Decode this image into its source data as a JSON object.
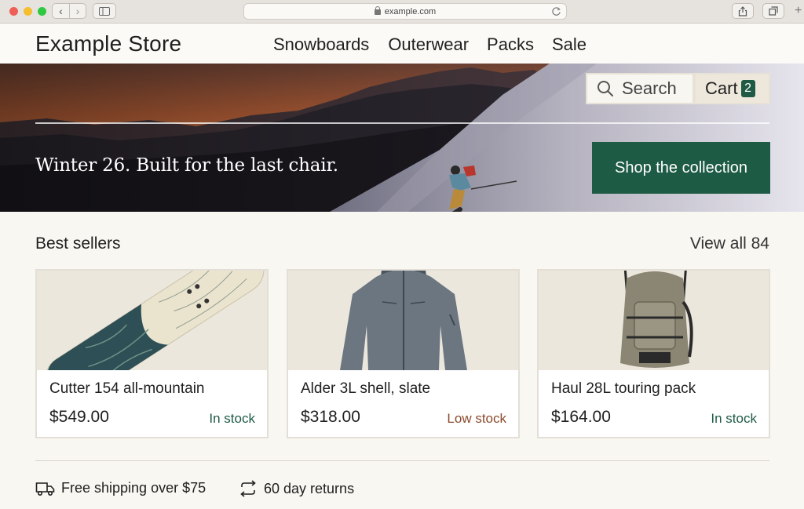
{
  "browser": {
    "url": "example.com"
  },
  "header": {
    "store_name": "Example Store",
    "nav": [
      "Snowboards",
      "Outerwear",
      "Packs",
      "Sale"
    ]
  },
  "hero": {
    "search_label": "Search",
    "cart_label": "Cart",
    "cart_count": "2",
    "headline": "Winter 26. Built for the last chair.",
    "cta": "Shop the collection"
  },
  "best_sellers": {
    "title": "Best sellers",
    "view_all": "View all 84",
    "products": [
      {
        "name": "Cutter 154 all-mountain",
        "price": "$549.00",
        "stock": "In stock"
      },
      {
        "name": "Alder 3L shell, slate",
        "price": "$318.00",
        "stock": "Low stock"
      },
      {
        "name": "Haul 28L touring pack",
        "price": "$164.00",
        "stock": "In stock"
      }
    ]
  },
  "perks": {
    "shipping": "Free shipping over $75",
    "returns": "60 day returns"
  },
  "colors": {
    "accent": "#1e5b45",
    "low_stock": "#8a4a2e",
    "page_bg": "#f9f7f2"
  }
}
